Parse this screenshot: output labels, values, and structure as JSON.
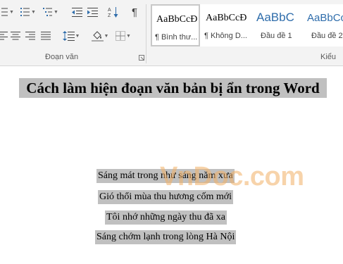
{
  "ribbon": {
    "paragraph_group_label": "Đoạn văn",
    "styles_group_label": "Kiểu",
    "buttons": [
      {
        "name": "bullets-icon"
      },
      {
        "name": "numbering-icon"
      },
      {
        "name": "multilevel-list-icon"
      },
      {
        "name": "decrease-indent-icon"
      },
      {
        "name": "increase-indent-icon"
      },
      {
        "name": "sort-icon"
      },
      {
        "name": "show-marks-icon",
        "glyph": "¶"
      },
      {
        "name": "align-left-icon"
      },
      {
        "name": "align-center-icon"
      },
      {
        "name": "align-right-icon"
      },
      {
        "name": "justify-icon"
      },
      {
        "name": "line-spacing-icon"
      },
      {
        "name": "shading-icon"
      },
      {
        "name": "borders-icon"
      }
    ],
    "styles": [
      {
        "sample": "AaBbCcĐ",
        "label": "¶ Bình thư...",
        "selected": true
      },
      {
        "sample": "AaBbCcĐ",
        "label": "¶ Không D...",
        "selected": false
      },
      {
        "sample": "AaBbC",
        "label": "Đầu đề 1",
        "selected": false
      },
      {
        "sample": "AaBbCc",
        "label": "Đầu đề 2",
        "selected": false
      }
    ]
  },
  "document": {
    "title": "Cách làm hiện đoạn văn bản bị ẩn trong Word",
    "lines": [
      "Sáng mát trong như sáng năm xưa",
      "Gió thổi mùa thu hương cốm mới",
      "Tôi nhớ những ngày thu đã xa",
      "Sáng chớm lạnh trong lòng Hà Nội"
    ],
    "highlight_color": "#c0c0c0"
  },
  "watermark": "VnDoc.com"
}
